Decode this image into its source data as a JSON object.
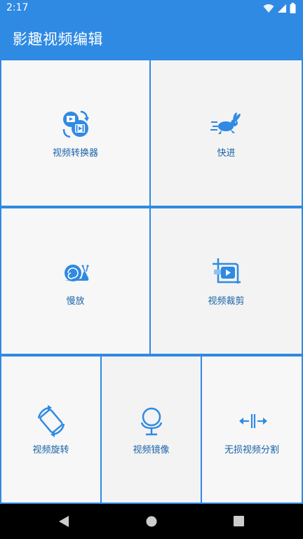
{
  "status": {
    "time": "2:17"
  },
  "app": {
    "title": "影趣视频编辑"
  },
  "tiles": {
    "converter": {
      "label": "视频转换器",
      "icon": "video-convert-icon"
    },
    "fast": {
      "label": "快进",
      "icon": "rabbit-icon"
    },
    "slow": {
      "label": "慢放",
      "icon": "snail-icon"
    },
    "crop": {
      "label": "视频裁剪",
      "icon": "crop-video-icon"
    },
    "rotate": {
      "label": "视频旋转",
      "icon": "rotate-icon"
    },
    "mirror": {
      "label": "视频镜像",
      "icon": "microphone-mirror-icon"
    },
    "split": {
      "label": "无损视频分割",
      "icon": "split-arrows-icon"
    }
  },
  "colors": {
    "accent": "#2f8ae3",
    "label": "#1a63a8",
    "tile": "#f7f7f7"
  }
}
